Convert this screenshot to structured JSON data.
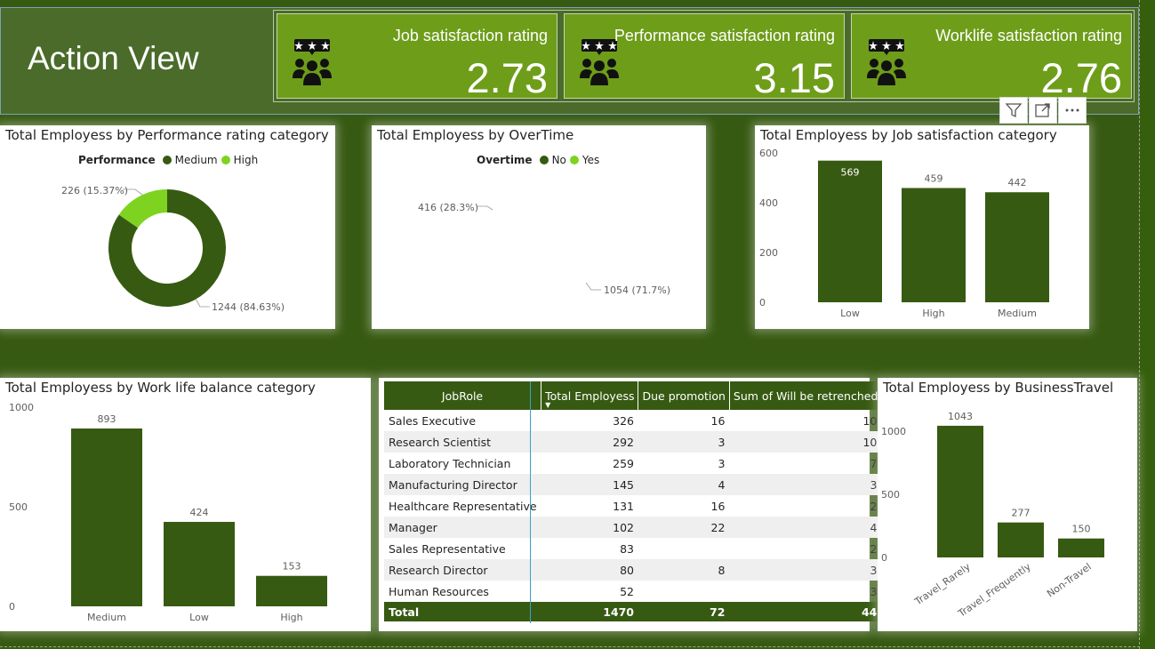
{
  "header": {
    "title": "Action View"
  },
  "kpis": [
    {
      "label": "Job satisfaction rating",
      "value": "2.73",
      "icon": "rating-people-icon"
    },
    {
      "label": "Performance satisfaction rating",
      "value": "3.15",
      "icon": "rating-people-icon"
    },
    {
      "label": "Worklife satisfaction rating",
      "value": "2.76",
      "icon": "rating-people-icon"
    }
  ],
  "visual_header_icons": [
    "filter-icon",
    "focus-mode-icon",
    "more-options-icon"
  ],
  "colors": {
    "dark_green": "#375a12",
    "light_green": "#7ed321",
    "kpi_green": "#6e9d1a"
  },
  "perf_chart": {
    "title": "Total Employess by Performance rating category",
    "legend_title": "Performance",
    "legend": [
      "Medium",
      "High"
    ],
    "labels": [
      "1244 (84.63%)",
      "226 (15.37%)"
    ]
  },
  "overtime_chart": {
    "title": "Total Employess by OverTime",
    "legend_title": "Overtime",
    "legend": [
      "No",
      "Yes"
    ],
    "labels": [
      "1054 (71.7%)",
      "416 (28.3%)"
    ]
  },
  "jobsat_chart": {
    "title": "Total Employess by Job satisfaction category"
  },
  "wlb_chart": {
    "title": "Total Employess by Work life balance category"
  },
  "travel_chart": {
    "title": "Total Employess by BusinessTravel"
  },
  "chart_data": [
    {
      "type": "pie",
      "title": "Total Employess by Performance rating category",
      "categories": [
        "Medium",
        "High"
      ],
      "values": [
        1244,
        226
      ],
      "percent": [
        84.63,
        15.37
      ],
      "legend_placement": "top"
    },
    {
      "type": "pie",
      "title": "Total Employess by OverTime",
      "categories": [
        "No",
        "Yes"
      ],
      "values": [
        1054,
        416
      ],
      "percent": [
        71.7,
        28.3
      ],
      "legend_placement": "top"
    },
    {
      "type": "bar",
      "title": "Total Employess by Job satisfaction category",
      "categories": [
        "Low",
        "High",
        "Medium"
      ],
      "values": [
        569,
        459,
        442
      ],
      "yticks": [
        0,
        200,
        400,
        600
      ],
      "ylim": [
        0,
        600
      ]
    },
    {
      "type": "bar",
      "title": "Total Employess by Work life balance category",
      "categories": [
        "Medium",
        "Low",
        "High"
      ],
      "values": [
        893,
        424,
        153
      ],
      "yticks": [
        0,
        500,
        1000
      ],
      "ylim": [
        0,
        1000
      ]
    },
    {
      "type": "bar",
      "title": "Total Employess by BusinessTravel",
      "categories": [
        "Travel_Rarely",
        "Travel_Frequently",
        "Non-Travel"
      ],
      "values": [
        1043,
        277,
        150
      ],
      "yticks": [
        0,
        500,
        1000
      ],
      "ylim": [
        0,
        1000
      ]
    }
  ],
  "table": {
    "columns": [
      "JobRole",
      "Total Employess",
      "Due promotion",
      "Sum of Will be retrenched"
    ],
    "rows": [
      [
        "Sales Executive",
        "326",
        "16",
        "10"
      ],
      [
        "Research Scientist",
        "292",
        "3",
        "10"
      ],
      [
        "Laboratory Technician",
        "259",
        "3",
        "7"
      ],
      [
        "Manufacturing Director",
        "145",
        "4",
        "3"
      ],
      [
        "Healthcare Representative",
        "131",
        "16",
        "2"
      ],
      [
        "Manager",
        "102",
        "22",
        "4"
      ],
      [
        "Sales Representative",
        "83",
        "",
        "2"
      ],
      [
        "Research Director",
        "80",
        "8",
        "3"
      ],
      [
        "Human Resources",
        "52",
        "",
        "3"
      ]
    ],
    "total": [
      "Total",
      "1470",
      "72",
      "44"
    ]
  }
}
